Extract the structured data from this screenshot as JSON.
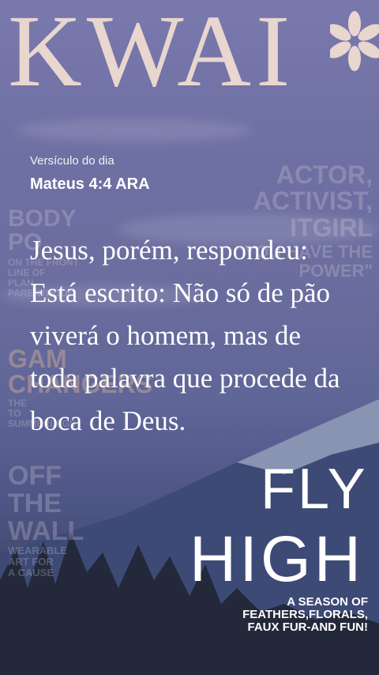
{
  "magazine": {
    "logo": "KWAI",
    "logo_mark": "snowflake-asterisk-icon",
    "cover_lines_left": [
      "BODY",
      "PO",
      "ON THE FRONT",
      "LINE OF",
      "PLAN",
      "PARENTHOOD"
    ],
    "cover_lines_right": [
      "ACTOR,",
      "ACTIVIST,",
      "ITGIRL",
      "\"YOU HAVE THE",
      "POWER\""
    ],
    "game_changers": [
      "GAM",
      "CHANGERS",
      "THE",
      "TO",
      "SUMMERLEGS"
    ],
    "off_wall": [
      "OFF",
      "THE",
      "WALL",
      "WEARABLE",
      "ART FOR",
      "A CAUSE"
    ],
    "fly": "FLY",
    "high": "HIGH",
    "season_lines": [
      "A SEASON OF",
      "FEATHERS,FLORALS,",
      "FAUX FUR-AND FUN!"
    ]
  },
  "verse": {
    "label": "Versículo do dia",
    "reference": "Mateus 4:4 ARA",
    "text": "Jesus, porém, respondeu: Está escrito: Não só de pão viverá o homem, mas de toda palavra que procede da boca de Deus."
  },
  "colors": {
    "sky": "#7a79ad",
    "logo": "#e8d6cf",
    "text": "#ffffff"
  }
}
